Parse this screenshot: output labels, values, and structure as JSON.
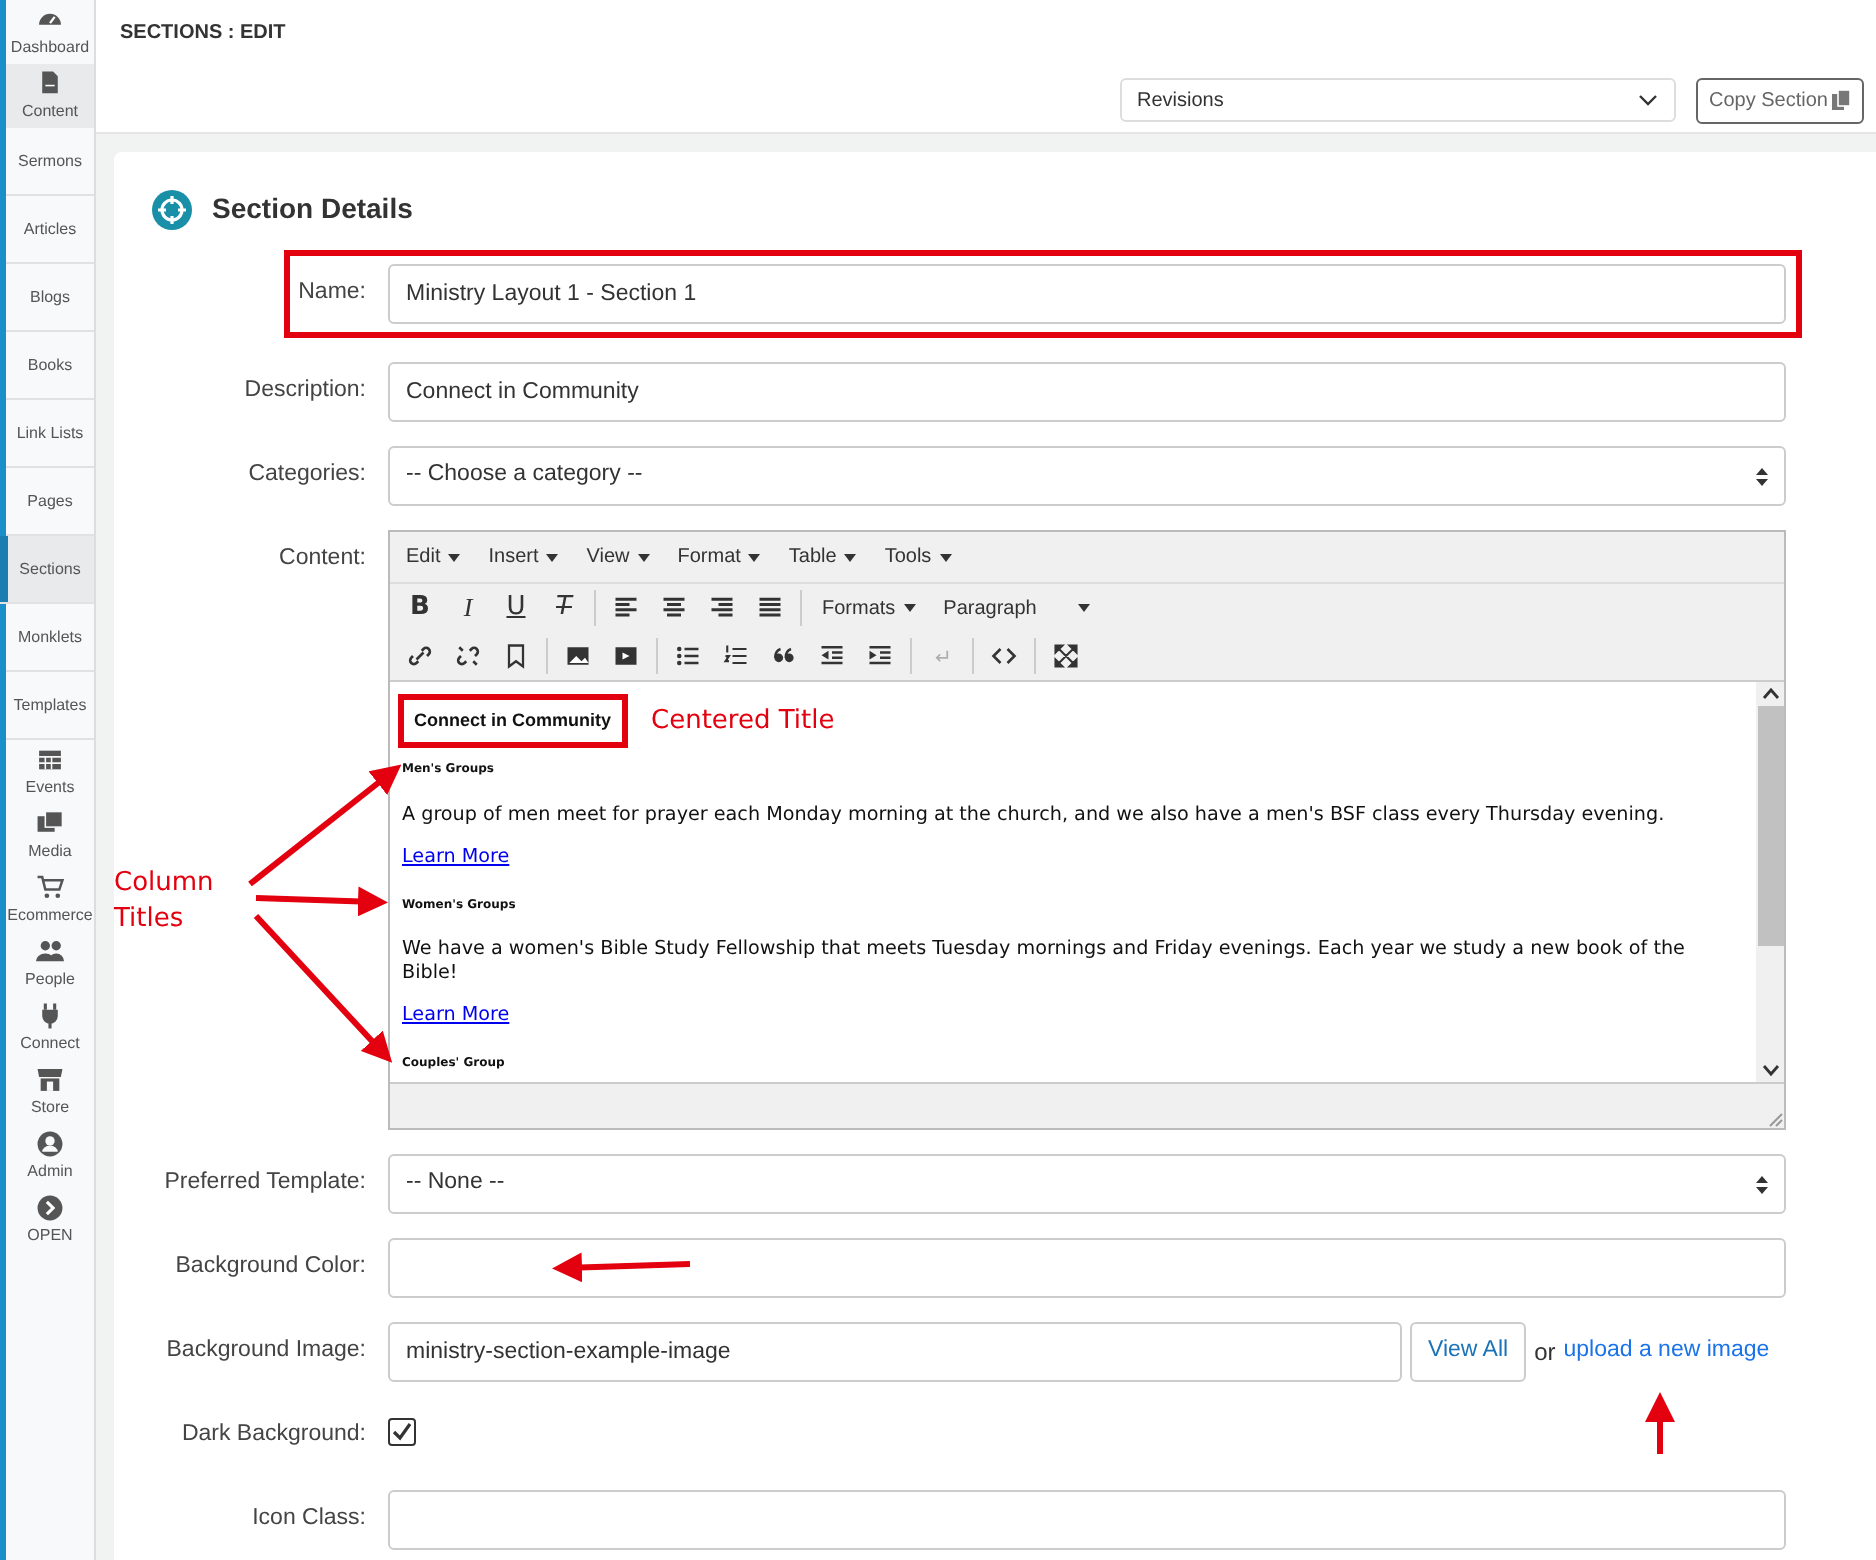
{
  "sidebar": {
    "items": [
      {
        "label": "Dashboard",
        "selected": false,
        "expanded": false
      },
      {
        "label": "Content",
        "selected": false,
        "expanded": true
      },
      {
        "label": "Sermons",
        "selected": false,
        "expanded": false
      },
      {
        "label": "Articles",
        "selected": false,
        "expanded": false
      },
      {
        "label": "Blogs",
        "selected": false,
        "expanded": false
      },
      {
        "label": "Books",
        "selected": false,
        "expanded": false
      },
      {
        "label": "Link Lists",
        "selected": false,
        "expanded": false
      },
      {
        "label": "Pages",
        "selected": false,
        "expanded": false
      },
      {
        "label": "Sections",
        "selected": true,
        "expanded": false
      },
      {
        "label": "Monklets",
        "selected": false,
        "expanded": false
      },
      {
        "label": "Templates",
        "selected": false,
        "expanded": false
      },
      {
        "label": "Events",
        "selected": false,
        "expanded": false
      },
      {
        "label": "Media",
        "selected": false,
        "expanded": false
      },
      {
        "label": "Ecommerce",
        "selected": false,
        "expanded": false
      },
      {
        "label": "People",
        "selected": false,
        "expanded": false
      },
      {
        "label": "Connect",
        "selected": false,
        "expanded": false
      },
      {
        "label": "Store",
        "selected": false,
        "expanded": false
      },
      {
        "label": "Admin",
        "selected": false,
        "expanded": false
      },
      {
        "label": "OPEN",
        "selected": false,
        "expanded": false
      }
    ]
  },
  "page_title": "SECTIONS : EDIT",
  "toolbar": {
    "revisions": "Revisions",
    "copy_button": "Copy Section"
  },
  "card": {
    "title": "Section Details",
    "fields": [
      {
        "label": "Name:",
        "kind": "text",
        "value": "Ministry Layout 1 - Section 1",
        "highlighted": true
      },
      {
        "label": "Description:",
        "kind": "text",
        "value": "Connect in Community",
        "highlighted": false
      },
      {
        "label": "Categories:",
        "kind": "select",
        "value": "-- Choose a category --",
        "highlighted": false
      },
      {
        "label": "Content:",
        "kind": "editor",
        "highlighted": false
      },
      {
        "label": "Preferred Template:",
        "kind": "select",
        "value": "-- None --",
        "highlighted": false
      },
      {
        "label": "Background Color:",
        "kind": "text",
        "highlighted": false
      },
      {
        "label": "Background Image:",
        "kind": "image",
        "value": "ministry-section-example-image",
        "button": "View All",
        "or_text": "or",
        "link": "upload a new image",
        "highlighted": false
      },
      {
        "label": "Dark Background:",
        "kind": "checkbox",
        "checked": true,
        "highlighted": false
      },
      {
        "label": "Icon Class:",
        "kind": "text",
        "highlighted": false
      }
    ]
  },
  "editor": {
    "menus": [
      "Edit",
      "Insert",
      "View",
      "Format",
      "Table",
      "Tools"
    ],
    "toolbar_rows": [
      [
        {
          "kind": "bold",
          "label": "B",
          "disabled": false
        },
        {
          "kind": "italic",
          "label": "I",
          "disabled": false
        },
        {
          "kind": "underline",
          "label": "U",
          "disabled": false
        },
        {
          "kind": "clear-format",
          "label": "T",
          "disabled": false
        },
        {
          "kind": "separator"
        },
        {
          "kind": "align-left",
          "disabled": false
        },
        {
          "kind": "align-center",
          "disabled": false
        },
        {
          "kind": "align-right",
          "disabled": false
        },
        {
          "kind": "justify",
          "disabled": false
        },
        {
          "kind": "separator"
        },
        {
          "kind": "dropdown",
          "label": "Formats",
          "disabled": false
        },
        {
          "kind": "dropdown",
          "label": "Paragraph",
          "disabled": false
        }
      ],
      [
        {
          "kind": "link",
          "disabled": false
        },
        {
          "kind": "unlink",
          "disabled": false
        },
        {
          "kind": "bookmark",
          "disabled": false
        },
        {
          "kind": "separator"
        },
        {
          "kind": "image",
          "disabled": false
        },
        {
          "kind": "media",
          "disabled": false
        },
        {
          "kind": "separator"
        },
        {
          "kind": "bullets",
          "disabled": false
        },
        {
          "kind": "numbers",
          "disabled": false
        },
        {
          "kind": "quote",
          "disabled": false
        },
        {
          "kind": "outdent",
          "disabled": false
        },
        {
          "kind": "indent",
          "disabled": false
        },
        {
          "kind": "separator"
        },
        {
          "kind": "enter",
          "disabled": true
        },
        {
          "kind": "separator"
        },
        {
          "kind": "code",
          "disabled": false
        },
        {
          "kind": "separator"
        },
        {
          "kind": "fullscreen",
          "disabled": false
        }
      ]
    ],
    "blocks": [
      {
        "kind": "title",
        "text": "Connect in Community",
        "highlighted": true
      },
      {
        "kind": "column-title",
        "text": "Men's Groups"
      },
      {
        "kind": "paragraph",
        "text": "A group of men meet for prayer each Monday morning at the church, and we also have a men's BSF class every Thursday evening."
      },
      {
        "kind": "link",
        "text": "Learn More"
      },
      {
        "kind": "column-title",
        "text": "Women's Groups"
      },
      {
        "kind": "paragraph",
        "text": "We have a women's Bible Study Fellowship that meets Tuesday mornings and Friday evenings. Each year we study a new book of the Bible!"
      },
      {
        "kind": "link",
        "text": "Learn More"
      },
      {
        "kind": "column-title",
        "text": "Couples' Group"
      }
    ]
  },
  "annotations": {
    "centered_title": "Centered Title",
    "column_titles": "Column Titles"
  }
}
